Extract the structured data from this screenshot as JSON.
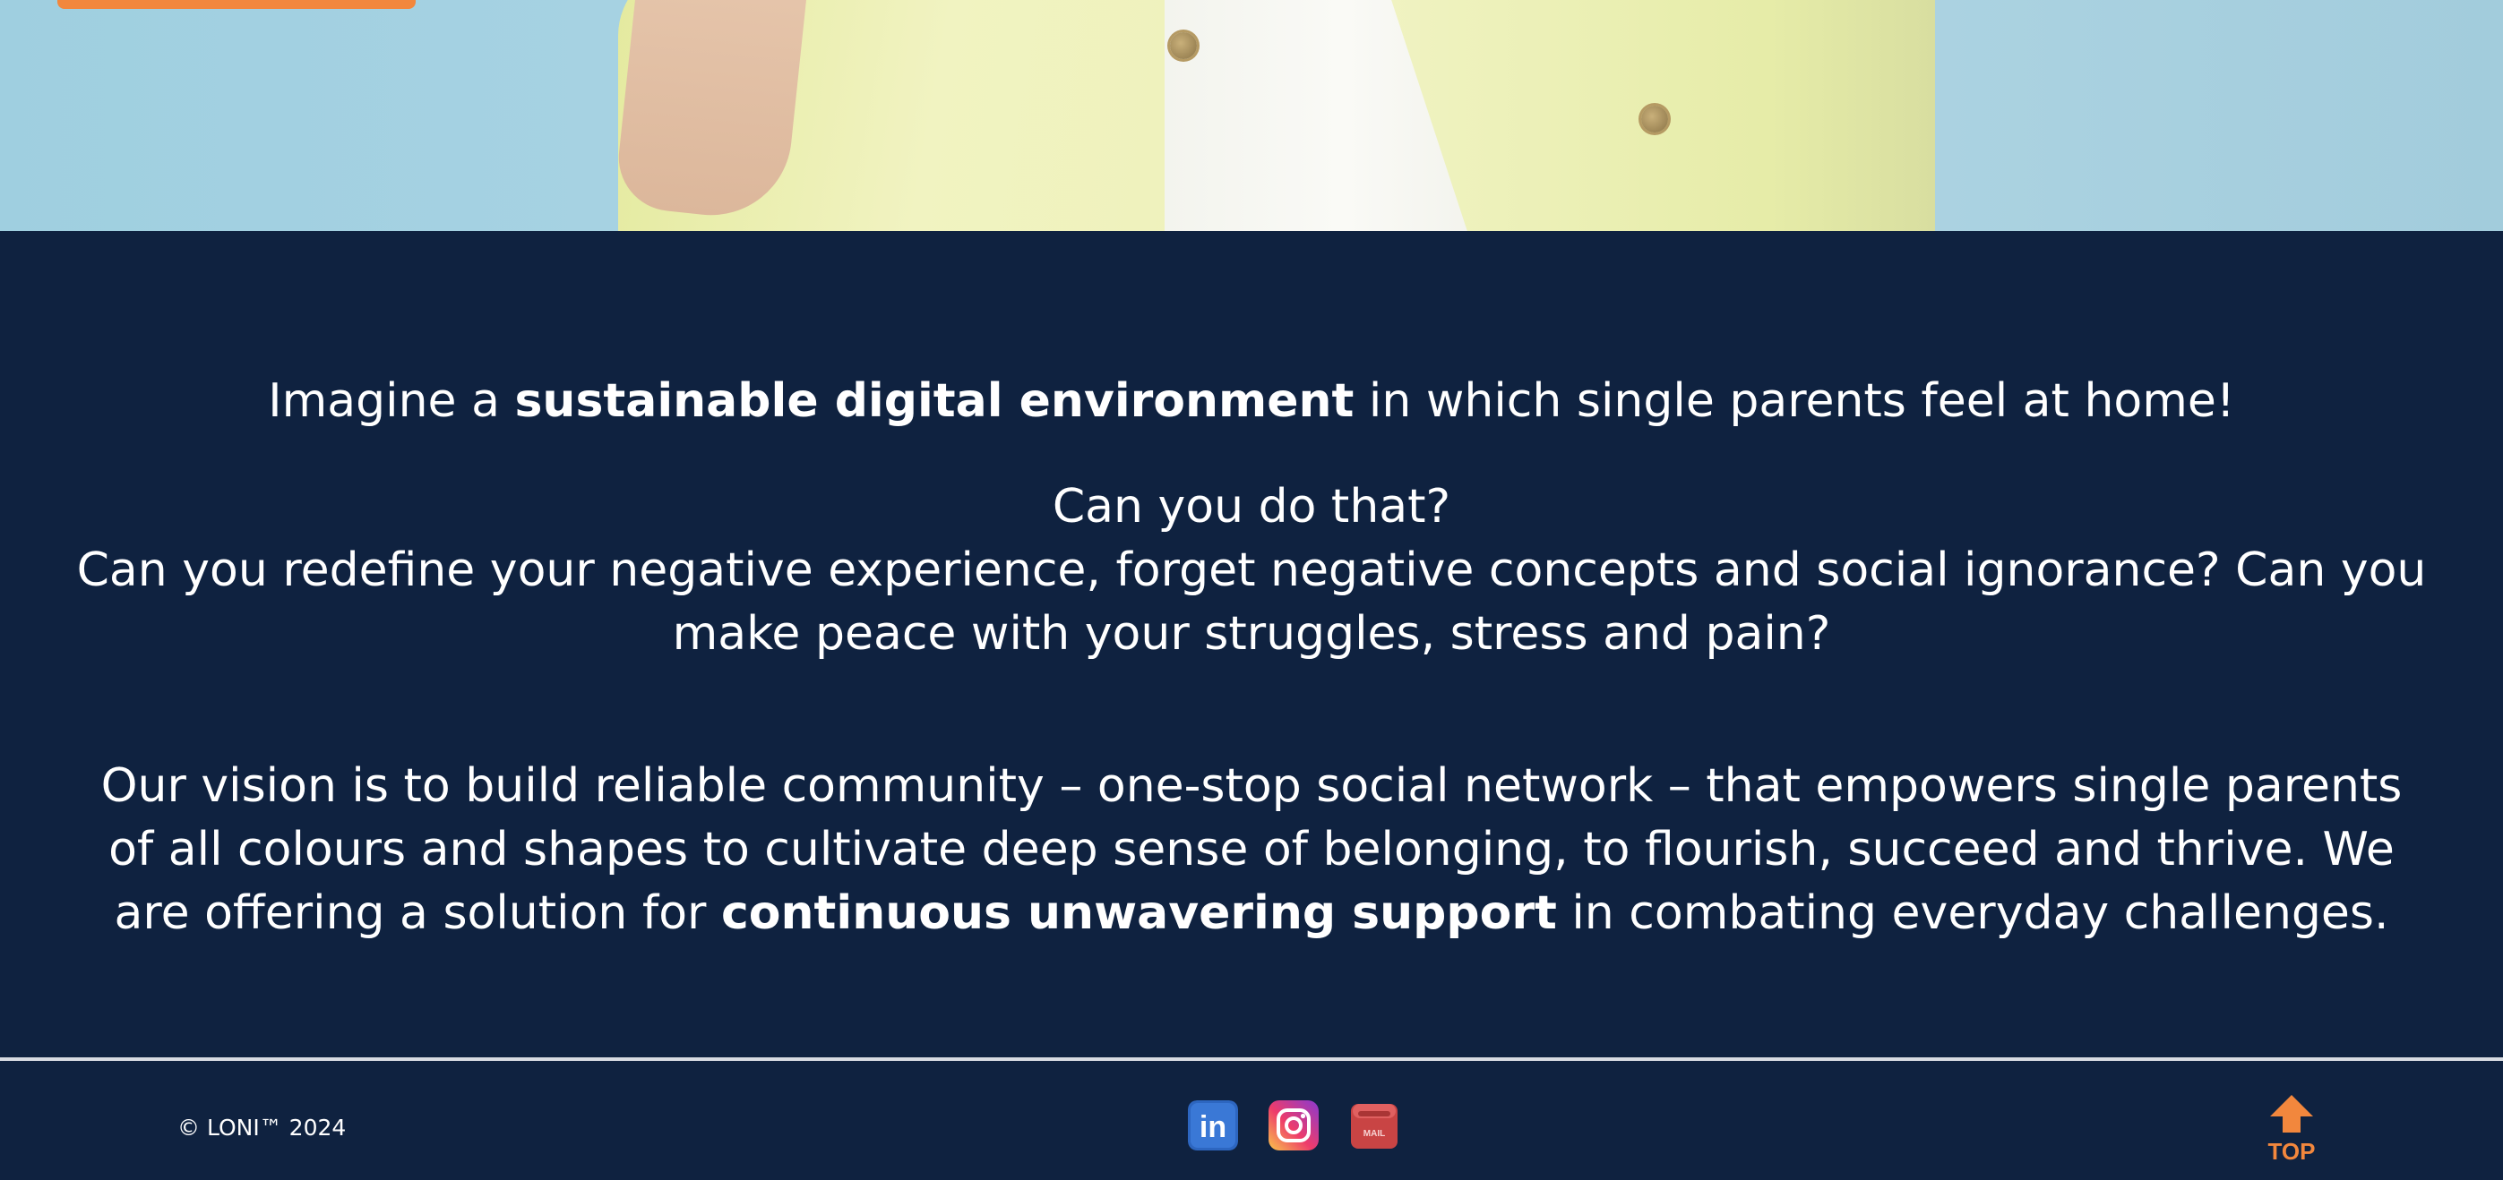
{
  "hero": {
    "image": "person-in-yellow-shirt-photo"
  },
  "content": {
    "line1_pre": "Imagine a ",
    "line1_bold": "sustainable digital environment",
    "line1_post": " in which single parents feel at home!",
    "line2": "Can you do that?",
    "line3": "Can you redefine your negative experience, forget negative concepts and social ignorance? Can you make peace with your struggles, stress and pain?",
    "vision_pre": "Our vision is to build reliable community – one-stop social network – that empowers single parents of all colours and shapes to cultivate deep sense of belonging, to flourish, succeed and thrive. We are offering a solution for ",
    "vision_bold": "continuous unwavering support",
    "vision_post": " in combating everyday challenges."
  },
  "footer": {
    "copyright": "© LONI™ 2024",
    "social": [
      {
        "name": "linkedin-icon",
        "label": "in"
      },
      {
        "name": "instagram-icon"
      },
      {
        "name": "mail-icon",
        "label": "MAIL"
      }
    ],
    "top_label": "TOP"
  },
  "colors": {
    "background": "#0f2240",
    "accent": "#f2873d",
    "text": "#ffffff"
  }
}
